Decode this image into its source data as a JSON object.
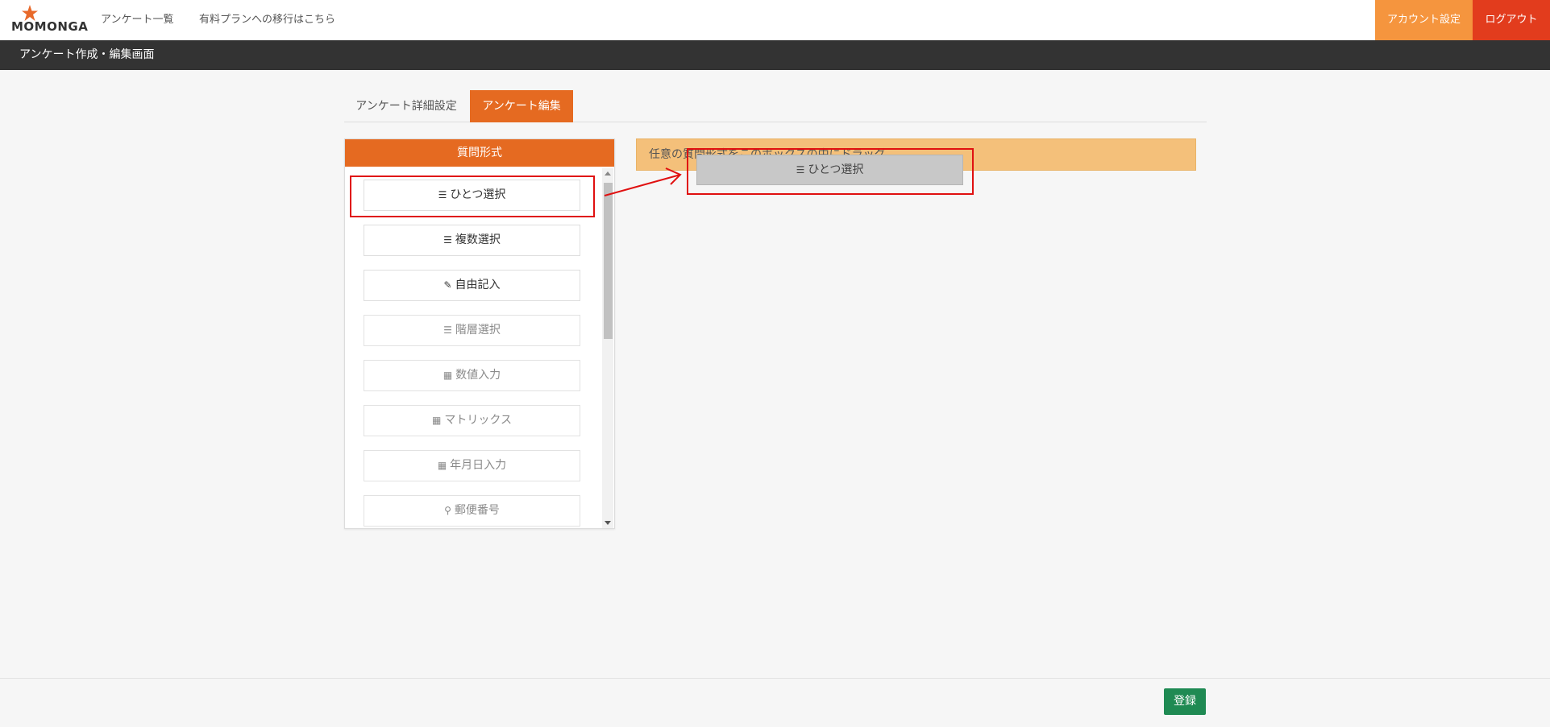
{
  "navbar": {
    "logo_text": "MOMONGA",
    "links": [
      "アンケート一覧",
      "有料プランへの移行はこちら"
    ],
    "account_label": "アカウント設定",
    "logout_label": "ログアウト"
  },
  "titlebar": {
    "title": "アンケート作成・編集画面"
  },
  "tabs": [
    {
      "label": "アンケート詳細設定",
      "active": false
    },
    {
      "label": "アンケート編集",
      "active": true
    }
  ],
  "question_panel": {
    "title": "質問形式",
    "items": [
      {
        "label": "ひとつ選択",
        "icon": "list-icon",
        "glyph": "☰",
        "enabled": true
      },
      {
        "label": "複数選択",
        "icon": "list-ol-icon",
        "glyph": "☰",
        "enabled": true
      },
      {
        "label": "自由記入",
        "icon": "pencil-icon",
        "glyph": "✎",
        "enabled": true
      },
      {
        "label": "階層選択",
        "icon": "indent-icon",
        "glyph": "☰",
        "enabled": false
      },
      {
        "label": "数値入力",
        "icon": "calculator-icon",
        "glyph": "▦",
        "enabled": false
      },
      {
        "label": "マトリックス",
        "icon": "table-icon",
        "glyph": "▦",
        "enabled": false
      },
      {
        "label": "年月日入力",
        "icon": "calendar-icon",
        "glyph": "▦",
        "enabled": false
      },
      {
        "label": "郵便番号",
        "icon": "map-marker-icon",
        "glyph": "⚲",
        "enabled": true
      }
    ]
  },
  "dropzone": {
    "text": "任意の質問形式をこのボックスの中にドラッグ"
  },
  "drag_ghost": {
    "label": "ひとつ選択",
    "icon": "list-icon",
    "glyph": "☰"
  },
  "footer": {
    "register_label": "登録"
  },
  "colors": {
    "accent": "#e56a21",
    "account": "#f5953e",
    "logout": "#e23c1d",
    "dropzone": "#f4c07a",
    "register": "#1f8a53",
    "annotation": "#e01010"
  }
}
